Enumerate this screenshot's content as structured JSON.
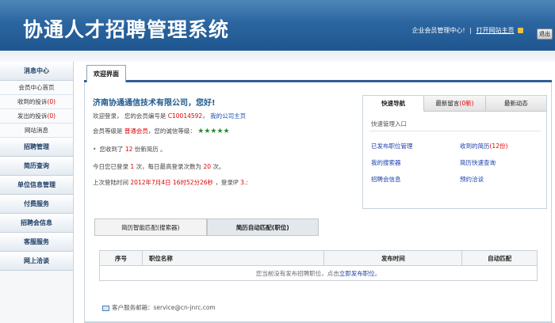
{
  "header": {
    "title": "协通人才招聘管理系统",
    "member_center": "企业会员管理中心!",
    "home_link": "打开网站主页",
    "exit": "退出"
  },
  "sidebar": {
    "message_center": "消息中心",
    "sub_items": [
      {
        "label": "会员中心首页",
        "count": ""
      },
      {
        "label": "收到的投诉",
        "count": "(0)"
      },
      {
        "label": "发出的投诉",
        "count": "(0)"
      },
      {
        "label": "网站消息",
        "count": ""
      }
    ],
    "sections": [
      "招聘管理",
      "简历查询",
      "单位信息管理",
      "付费服务",
      "招聘会信息",
      "客服服务",
      "网上洽谈"
    ]
  },
  "main": {
    "tab": "欢迎界面",
    "welcome": "济南协通通信技术有限公司，您好!",
    "line1": {
      "prefix": "欢迎登录，  您的会员编号是",
      "number": "C10014592",
      "sep": "，",
      "link": "我的公司主页"
    },
    "line2": {
      "prefix": "会员等级是",
      "level": "普通会员",
      "suffix": "，您的诚信等级：",
      "stars": "★★★★★"
    },
    "line3": {
      "prefix": "您收到了",
      "count": "12",
      "suffix": "份新简历 。"
    },
    "line4": {
      "prefix": "今日您已登录",
      "login": "1",
      "mid": "次，每日最高登录次数为",
      "max": "20",
      "suffix": "次。"
    },
    "line5": {
      "prefix": "上次登陆时间",
      "time": "2012年7月4日 16时52分26秒",
      "mid": "，登录IP",
      "ip": "3.:"
    }
  },
  "quick_panel": {
    "tabs": [
      {
        "label": "快速导航",
        "count": "",
        "after": ""
      },
      {
        "label": "最新留言",
        "count": "(0新)",
        "after": ""
      },
      {
        "label": "最新动态",
        "count": "",
        "after": ""
      }
    ],
    "entry_title": "快速管理入口",
    "links_left": [
      "已发布职位管理",
      "我的搜索器",
      "招聘会信息"
    ],
    "links_right": [
      {
        "label": "收到的简历",
        "count": "(12份)"
      },
      {
        "label": "简历快速查询",
        "count": ""
      },
      {
        "label": "预约洽谈",
        "count": ""
      }
    ]
  },
  "match_tabs": [
    "简历智能匹配(搜索器)",
    "简历自动匹配(职位)"
  ],
  "table": {
    "headers": [
      "序号",
      "职位名称",
      "发布时间",
      "自动匹配"
    ],
    "empty_prefix": "您当前没有发布招聘职位，点击",
    "empty_link": "立即发布职位",
    "empty_suffix": "。"
  },
  "footer": {
    "mail_label": "客户服务邮箱：",
    "mail": "service@cn-jnrc.com"
  }
}
